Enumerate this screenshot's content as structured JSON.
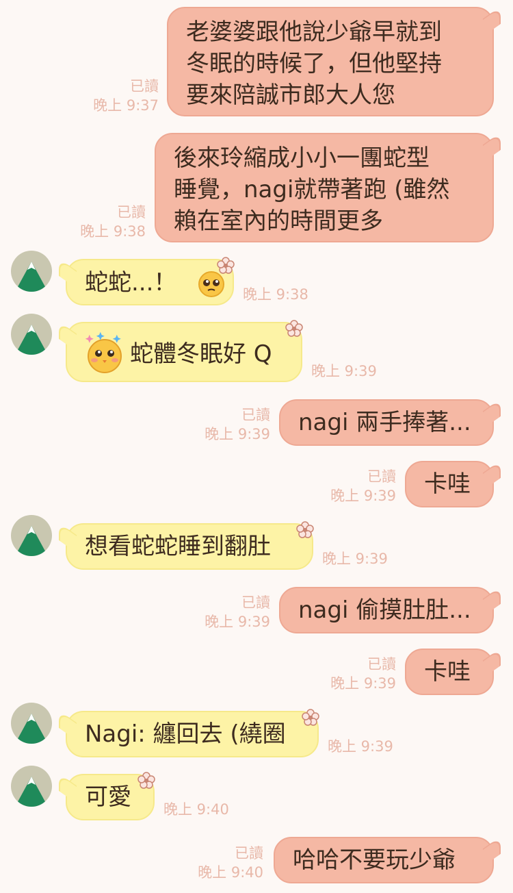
{
  "read_label": "已讀",
  "messages": [
    {
      "lines": [
        "老婆婆跟他說少爺早就到",
        "冬眠的時候了，但他堅持",
        "要來陪誠市郎大人您"
      ],
      "time": "晚上 9:37"
    },
    {
      "lines": [
        "後來玲縮成小小一團蛇型",
        "睡覺，nagi就帶著跑 (雖然",
        "賴在室內的時間更多"
      ],
      "time": "晚上 9:38"
    },
    {
      "text": "蛇蛇...！",
      "emoji": "pleading-face",
      "time": "晚上 9:38"
    },
    {
      "text": "蛇體冬眠好 Q",
      "emoji": "sparkle-chick-sticker",
      "time": "晚上 9:39"
    },
    {
      "text": "nagi 兩手捧著...",
      "time": "晚上 9:39"
    },
    {
      "text": "卡哇",
      "time": "晚上 9:39"
    },
    {
      "text": "想看蛇蛇睡到翻肚",
      "time": "晚上 9:39"
    },
    {
      "text": "nagi 偷摸肚肚...",
      "time": "晚上 9:39"
    },
    {
      "text": "卡哇",
      "time": "晚上 9:39"
    },
    {
      "text": "Nagi: 纏回去 (繞圈",
      "time": "晚上 9:39"
    },
    {
      "text": "可愛",
      "time": "晚上 9:40"
    },
    {
      "text": "哈哈不要玩少爺",
      "time": "晚上 9:40"
    }
  ],
  "colors": {
    "outgoing_bubble": "#f5b8a4",
    "incoming_bubble": "#fdf3a6",
    "meta_text": "#e8b8a9",
    "background": "#fdf8f5"
  }
}
